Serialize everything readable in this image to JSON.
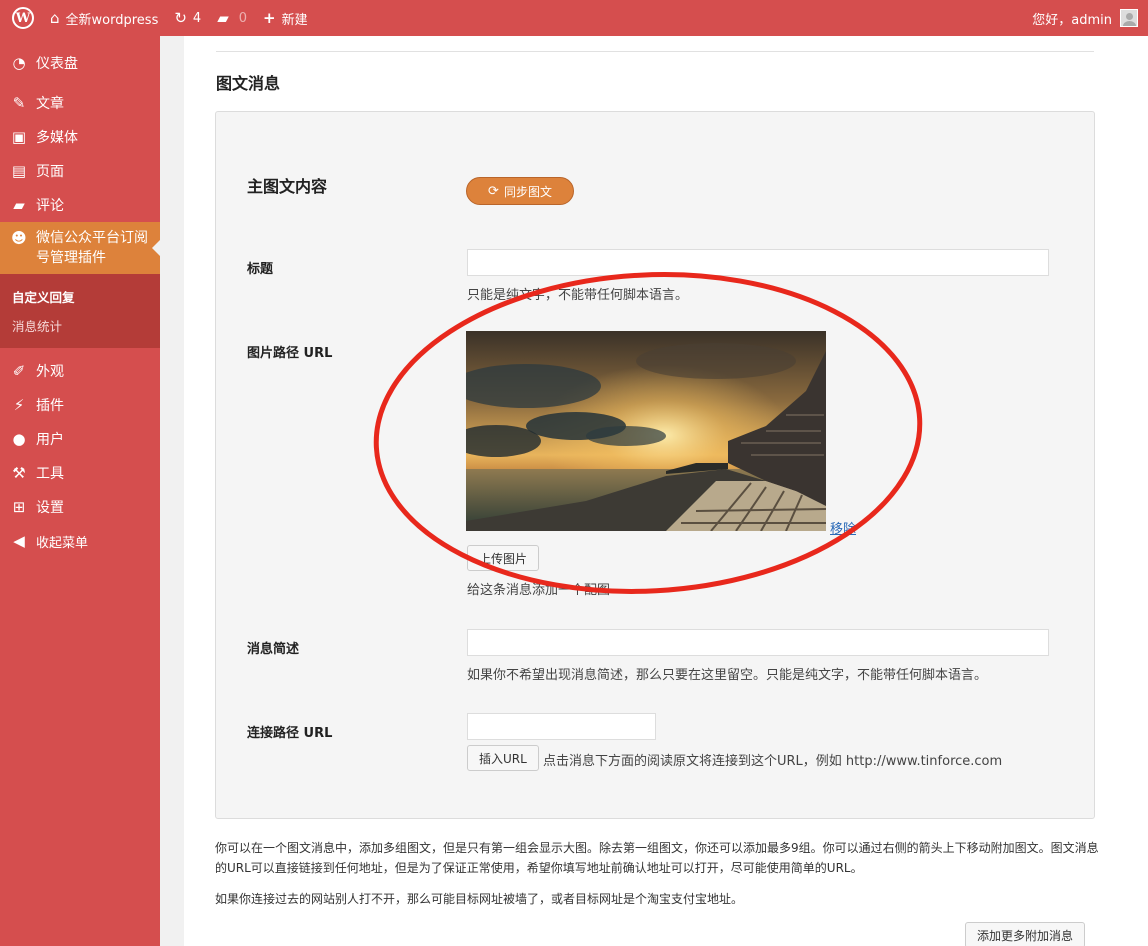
{
  "adminbar": {
    "site_name": "全新wordpress",
    "updates_count": "4",
    "comments_count": "0",
    "new_label": "新建",
    "greeting": "您好，admin"
  },
  "sidebar": {
    "items": [
      {
        "icon": "dashboard-icon",
        "label": "仪表盘"
      },
      {
        "icon": "pin-icon",
        "label": "文章"
      },
      {
        "icon": "media-icon",
        "label": "多媒体"
      },
      {
        "icon": "page-icon",
        "label": "页面"
      },
      {
        "icon": "comment-icon",
        "label": "评论"
      }
    ],
    "active_item": {
      "icon": "wechat-plugin-icon",
      "label_line1": "微信公众平台订阅",
      "label_line2": "号管理插件"
    },
    "submenu": [
      {
        "label": "自定义回复",
        "current": true
      },
      {
        "label": "消息统计",
        "current": false
      }
    ],
    "items_after": [
      {
        "icon": "appearance-icon",
        "label": "外观"
      },
      {
        "icon": "plugin-icon",
        "label": "插件"
      },
      {
        "icon": "user-icon",
        "label": "用户"
      },
      {
        "icon": "wrench-icon",
        "label": "工具"
      },
      {
        "icon": "settings-icon",
        "label": "设置"
      },
      {
        "icon": "collapse-icon",
        "label": "收起菜单"
      }
    ]
  },
  "main": {
    "section_title": "图文消息",
    "panel": {
      "heading": "主图文内容",
      "sync_button": "同步图文",
      "title_label": "标题",
      "title_value": "",
      "title_help": "只能是纯文字，不能带任何脚本语言。",
      "image_label": "图片路径 URL",
      "remove_link": "移除",
      "upload_button": "上传图片",
      "image_help": "给这条消息添加一个配图",
      "summary_label": "消息简述",
      "summary_value": "",
      "summary_help": "如果你不希望出现消息简述，那么只要在这里留空。只能是纯文字，不能带任何脚本语言。",
      "link_label": "连接路径 URL",
      "link_value": "",
      "insert_url_button": "插入URL",
      "link_help": "点击消息下方面的阅读原文将连接到这个URL，例如 http://www.tinforce.com"
    },
    "note1": "你可以在一个图文消息中，添加多组图文，但是只有第一组会显示大图。除去第一组图文，你还可以添加最多9组。你可以通过右侧的箭头上下移动附加图文。图文消息的URL可以直接链接到任何地址，但是为了保证正常使用，希望你填写地址前确认地址可以打开，尽可能使用简单的URL。",
    "note2": "如果你连接过去的网站别人打不开，那么可能目标网址被墙了，或者目标网址是个淘宝支付宝地址。",
    "add_more_button": "添加更多附加消息"
  },
  "colors": {
    "admin_red": "#d54e4e",
    "accent_orange": "#dd823b",
    "annotation_red": "#e8281c"
  }
}
